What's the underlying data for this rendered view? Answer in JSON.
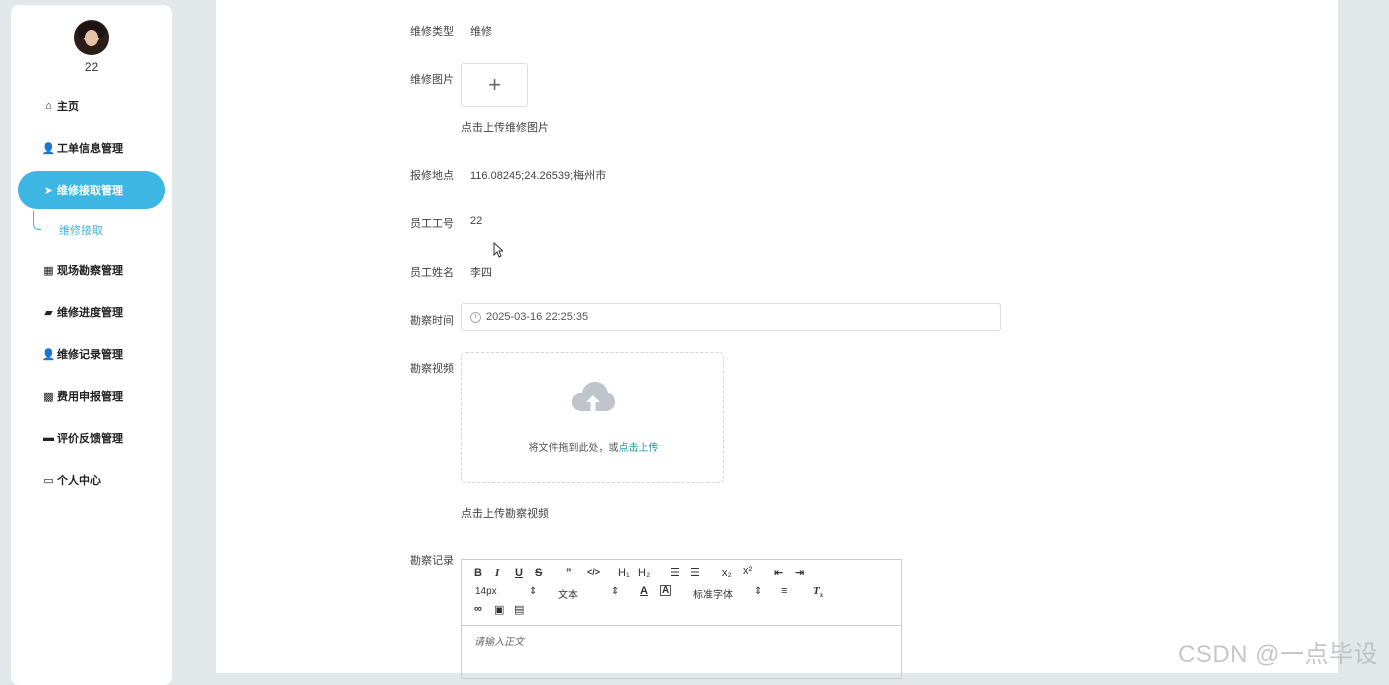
{
  "user": {
    "name": "22"
  },
  "sidebar": {
    "items": [
      {
        "label": "主页",
        "icon": "home-icon",
        "glyph": "⌂"
      },
      {
        "label": "工单信息管理",
        "icon": "user-icon",
        "glyph": "👤"
      },
      {
        "label": "维修接取管理",
        "icon": "paper-plane-icon",
        "glyph": "➤",
        "active": true
      },
      {
        "label": "现场勘察管理",
        "icon": "grid-icon",
        "glyph": "▦"
      },
      {
        "label": "维修进度管理",
        "icon": "briefcase-icon",
        "glyph": "▰"
      },
      {
        "label": "维修记录管理",
        "icon": "person-icon",
        "glyph": "👤"
      },
      {
        "label": "费用申报管理",
        "icon": "apps-icon",
        "glyph": "▩"
      },
      {
        "label": "评价反馈管理",
        "icon": "toolbox-icon",
        "glyph": "▬"
      },
      {
        "label": "个人中心",
        "icon": "card-icon",
        "glyph": "▭"
      }
    ],
    "submenu": {
      "label": "维修接取"
    }
  },
  "form": {
    "repair_type": {
      "label": "维修类型",
      "value": "维修"
    },
    "repair_image": {
      "label": "维修图片",
      "plus": "+",
      "hint": "点击上传维修图片"
    },
    "location": {
      "label": "报修地点",
      "value": "116.08245;24.26539;梅州市"
    },
    "employee_id": {
      "label": "员工工号",
      "value": "22"
    },
    "employee_name": {
      "label": "员工姓名",
      "value": "李四"
    },
    "survey_time": {
      "label": "勘察时间",
      "value": "2025-03-16 22:25:35"
    },
    "survey_video": {
      "label": "勘察视频",
      "drag_text": "将文件拖到此处，或",
      "drag_link": "点击上传",
      "hint": "点击上传勘察视频"
    },
    "survey_record": {
      "label": "勘察记录",
      "placeholder": "请输入正文"
    }
  },
  "editor": {
    "font_size": "14px",
    "text_style": "文本",
    "font_family": "标准字体"
  },
  "watermark": "CSDN @一点毕设"
}
